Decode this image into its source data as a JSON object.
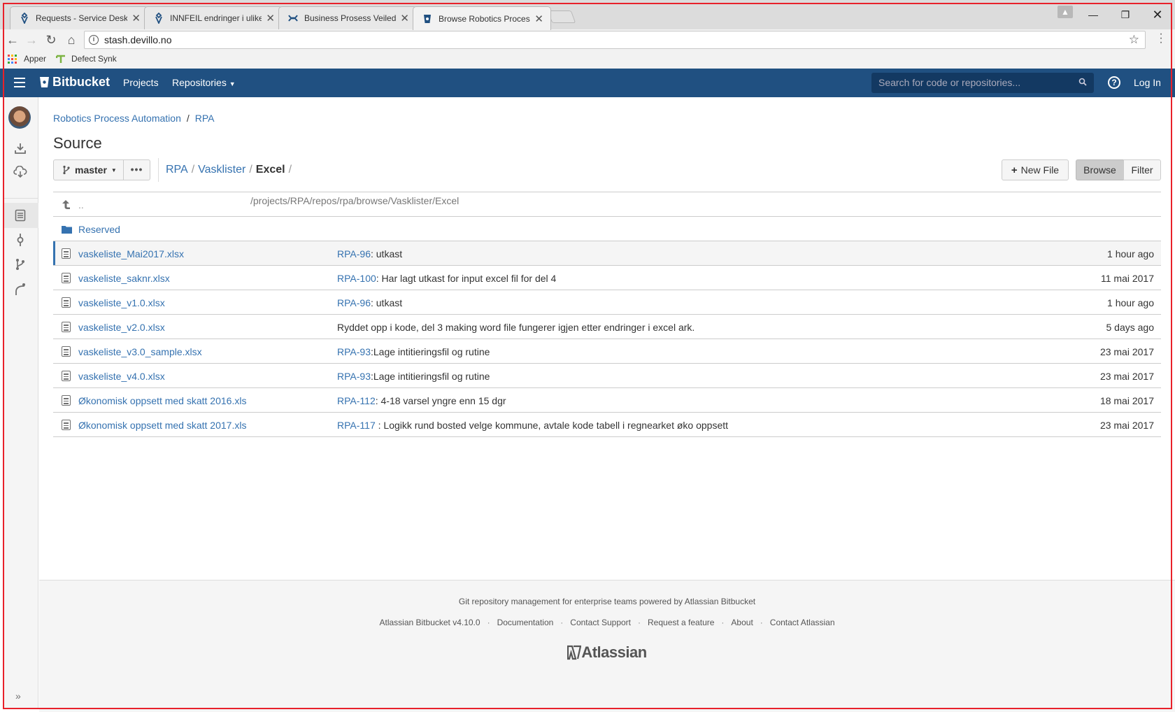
{
  "browser": {
    "tabs": [
      {
        "title": "Requests - Service Desk",
        "active": false
      },
      {
        "title": "INNFEIL endringer i ulike",
        "active": false
      },
      {
        "title": "Business Prosess Veiledn",
        "active": false
      },
      {
        "title": "Browse Robotics Process",
        "active": true
      }
    ],
    "url_host": "stash.devillo.no",
    "url_path": "/projects/RPA/repos/rpa/browse/Vasklister/Excel",
    "bookmarks": [
      {
        "label": "Apper",
        "icon": "apps-grid-icon"
      },
      {
        "label": "Defect Synk",
        "icon": "bookmark-favicon"
      }
    ]
  },
  "header": {
    "logo": "Bitbucket",
    "nav": [
      "Projects",
      "Repositories"
    ],
    "search_placeholder": "Search for code or repositories...",
    "login": "Log In",
    "help": "?",
    "brand_color": "#205081"
  },
  "breadcrumb": {
    "project": "Robotics Process Automation",
    "repo": "RPA",
    "separator": "/"
  },
  "page_title": "Source",
  "toolbar": {
    "branch": "master",
    "more": "•••",
    "path": [
      "RPA",
      "Vasklister"
    ],
    "current": "Excel",
    "new_file": "New File",
    "browse": "Browse",
    "filter": "Filter"
  },
  "files": {
    "parent": "..",
    "folder": "Reserved",
    "rows": [
      {
        "name": "vaskeliste_Mai2017.xlsx",
        "key": "RPA-96",
        "msg": ": utkast",
        "time": "1 hour ago"
      },
      {
        "name": "vaskeliste_saknr.xlsx",
        "key": "RPA-100",
        "msg": ": Har lagt utkast for input excel fil for del 4",
        "time": "11 mai 2017"
      },
      {
        "name": "vaskeliste_v1.0.xlsx",
        "key": "RPA-96",
        "msg": ": utkast",
        "time": "1 hour ago"
      },
      {
        "name": "vaskeliste_v2.0.xlsx",
        "key": "",
        "msg": "Ryddet opp i kode, del 3 making word file fungerer igjen etter endringer i excel ark.",
        "time": "5 days ago"
      },
      {
        "name": "vaskeliste_v3.0_sample.xlsx",
        "key": "RPA-93",
        "msg": ":Lage intitieringsfil og rutine",
        "time": "23 mai 2017"
      },
      {
        "name": "vaskeliste_v4.0.xlsx",
        "key": "RPA-93",
        "msg": ":Lage intitieringsfil og rutine",
        "time": "23 mai 2017"
      },
      {
        "name": "Økonomisk oppsett med skatt 2016.xls",
        "key": "RPA-112",
        "msg": ": 4-18 varsel yngre enn 15 dgr",
        "time": "18 mai 2017"
      },
      {
        "name": "Økonomisk oppsett med skatt 2017.xls",
        "key": "RPA-117",
        "msg": " : Logikk rund bosted velge kommune, avtale kode tabell i regnearket øko oppsett",
        "time": "23 mai 2017"
      }
    ]
  },
  "footer": {
    "tagline": "Git repository management for enterprise teams powered by Atlassian Bitbucket",
    "links": [
      "Atlassian Bitbucket v4.10.0",
      "Documentation",
      "Contact Support",
      "Request a feature",
      "About",
      "Contact Atlassian"
    ],
    "logo": "Atlassian"
  }
}
